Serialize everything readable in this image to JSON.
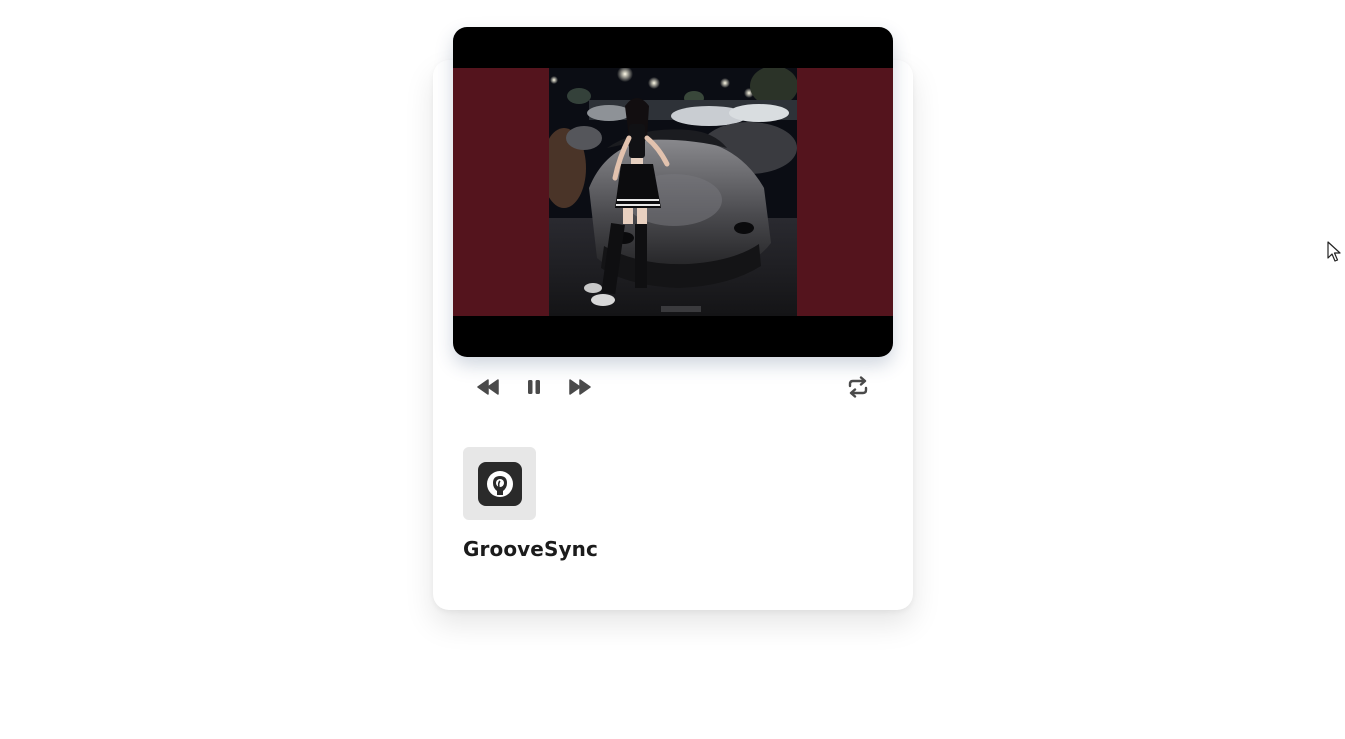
{
  "player": {
    "thumbnail_image": "photo-thumbnail",
    "controls": {
      "rewind_icon": "rewind-icon",
      "pause_icon": "pause-icon",
      "fast_forward_icon": "fast-forward-icon",
      "repeat_icon": "repeat-icon"
    },
    "frame_color": "#54141d"
  },
  "app": {
    "icon": "groovesync-logo-icon",
    "name": "GrooveSync"
  }
}
